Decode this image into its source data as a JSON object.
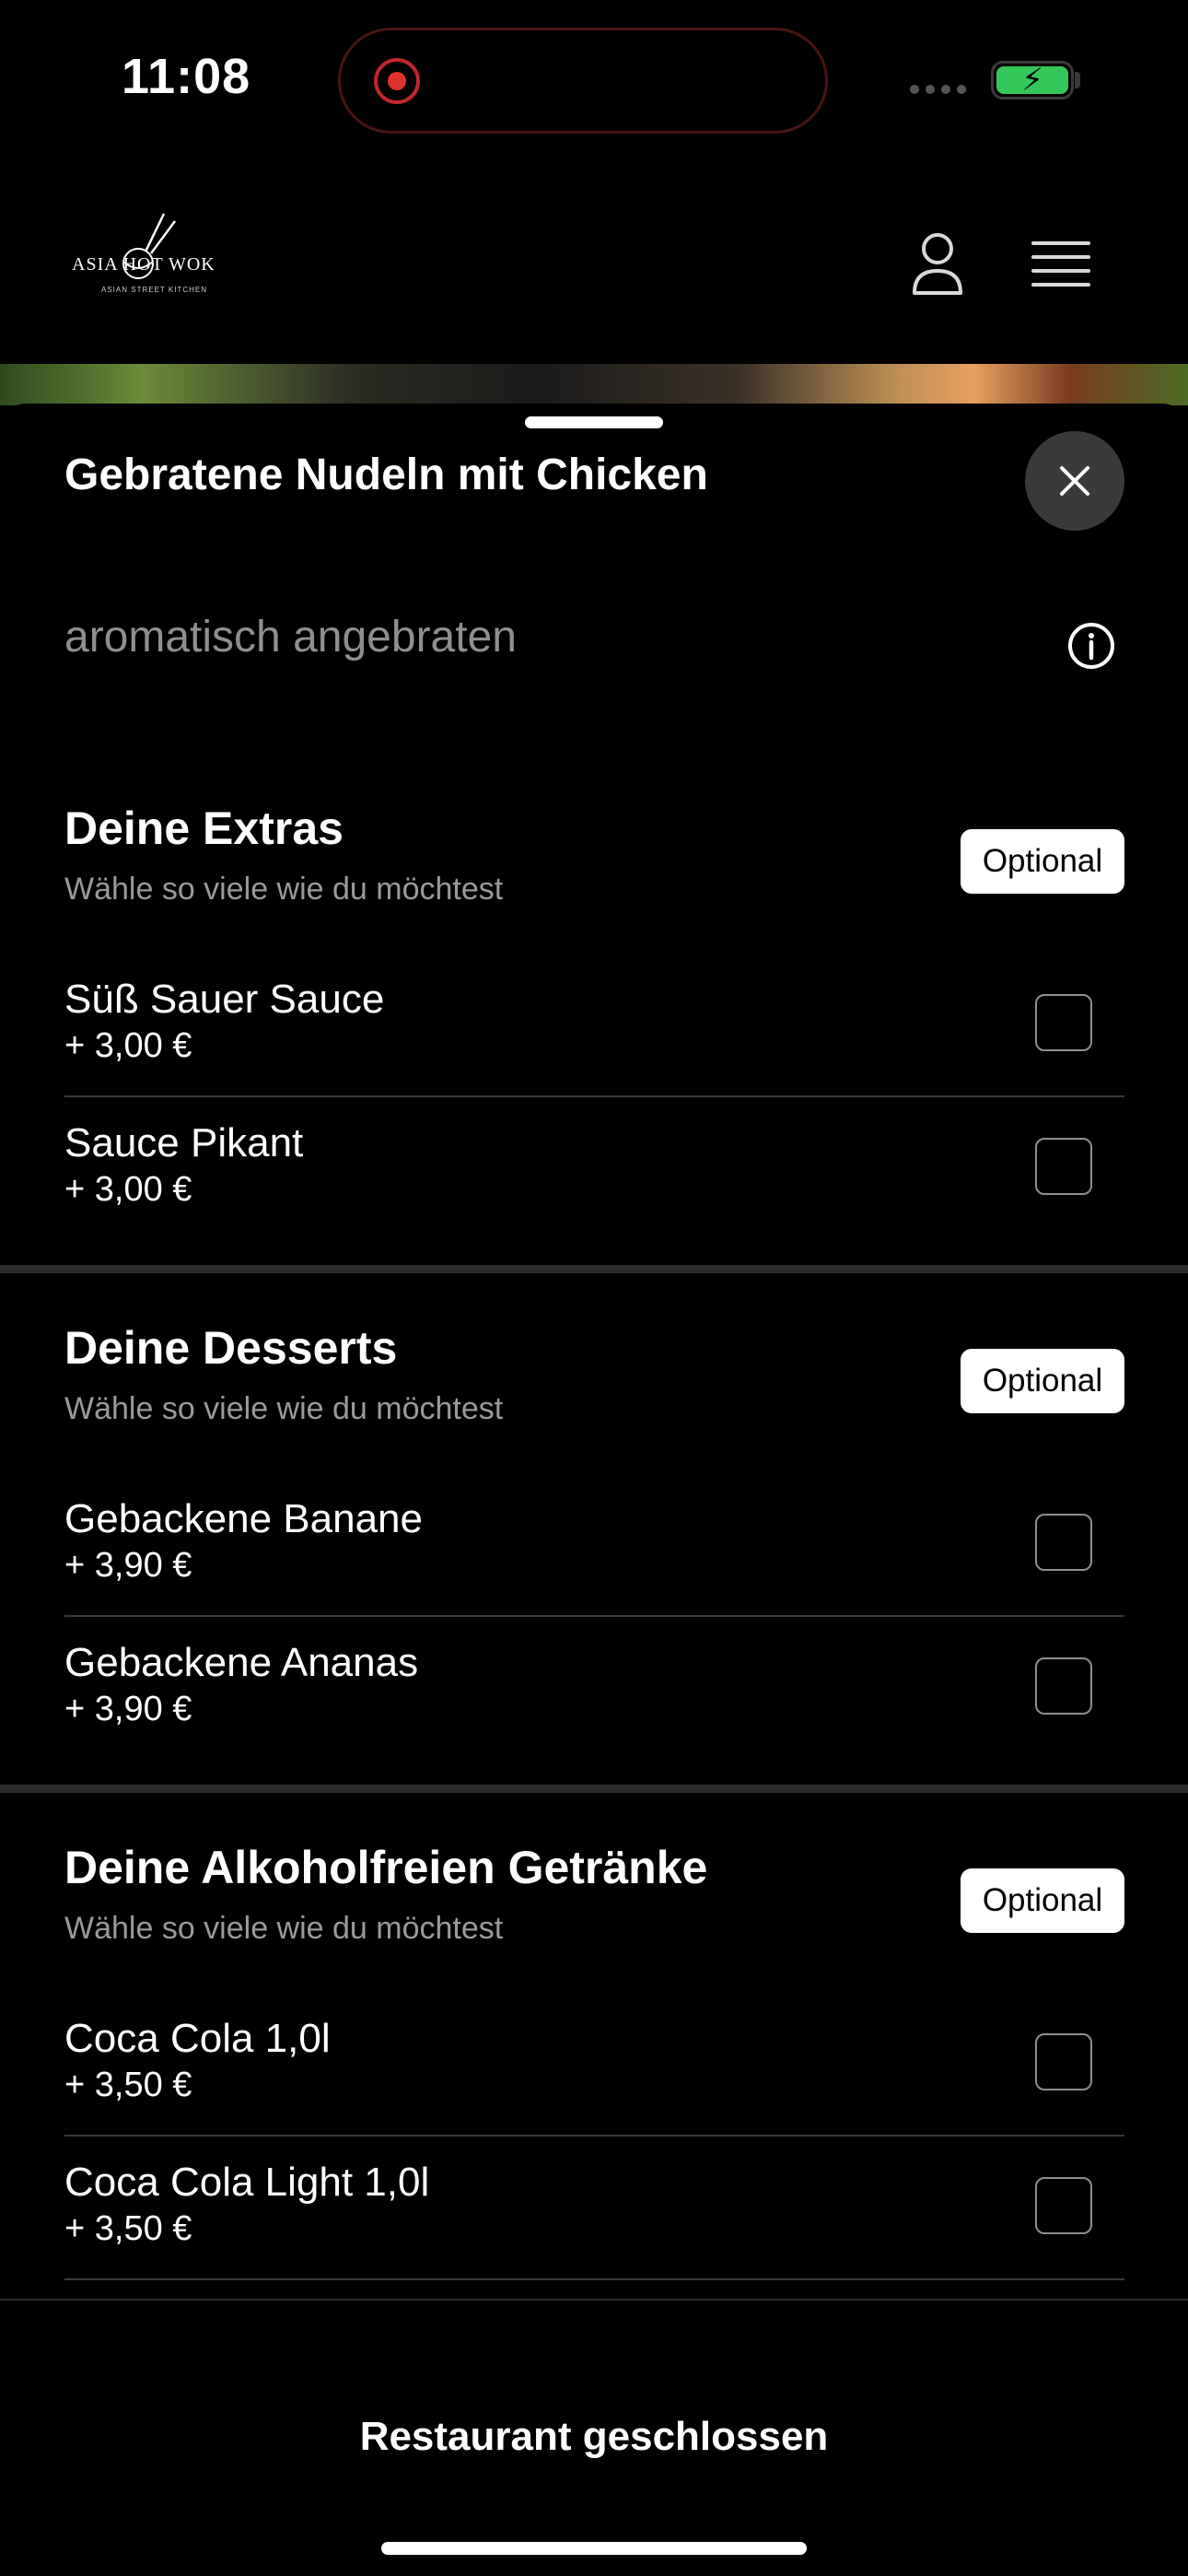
{
  "status_bar": {
    "time": "11:08"
  },
  "header": {
    "logo_text": "ASIA HOT WOK",
    "logo_subtext": "ASIAN STREET KITCHEN"
  },
  "item": {
    "title": "Gebratene Nudeln mit Chicken",
    "description": "aromatisch angebraten"
  },
  "sections": [
    {
      "title": "Deine Extras",
      "hint": "Wähle so viele wie du möchtest",
      "badge": "Optional",
      "options": [
        {
          "name": "Süß Sauer Sauce",
          "price": "+ 3,00 €",
          "checked": false
        },
        {
          "name": "Sauce Pikant",
          "price": "+ 3,00 €",
          "checked": false
        }
      ]
    },
    {
      "title": "Deine Desserts",
      "hint": "Wähle so viele wie du möchtest",
      "badge": "Optional",
      "options": [
        {
          "name": "Gebackene Banane",
          "price": "+ 3,90 €",
          "checked": false
        },
        {
          "name": "Gebackene Ananas",
          "price": "+ 3,90 €",
          "checked": false
        }
      ]
    },
    {
      "title": "Deine Alkoholfreien Getränke",
      "hint": "Wähle so viele wie du möchtest",
      "badge": "Optional",
      "options": [
        {
          "name": "Coca Cola 1,0l",
          "price": "+ 3,50 €",
          "checked": false
        },
        {
          "name": "Coca Cola Light 1,0l",
          "price": "+ 3,50 €",
          "checked": false
        }
      ]
    }
  ],
  "footer": {
    "status": "Restaurant geschlossen"
  },
  "colors": {
    "battery": "#34c759",
    "recording": "#e0312f",
    "close_button_bg": "#3a3a3c"
  },
  "icons": [
    "recording-icon",
    "battery-charging-icon",
    "user-icon",
    "hamburger-menu-icon",
    "close-icon",
    "info-icon",
    "checkbox-icon"
  ]
}
